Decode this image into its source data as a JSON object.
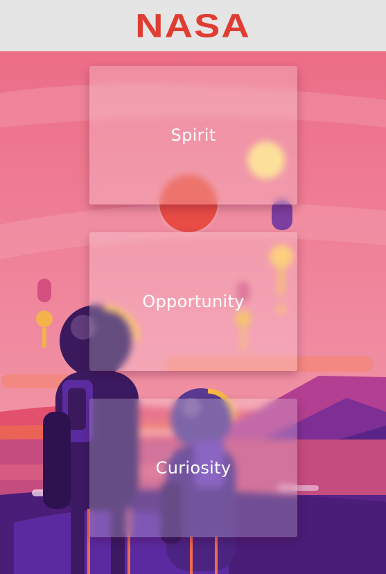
{
  "header": {
    "logo_text": "NASA",
    "logo_color": "#e03c31",
    "background": "#e5e5e5"
  },
  "rovers": [
    {
      "label": "Spirit"
    },
    {
      "label": "Opportunity"
    },
    {
      "label": "Curiosity"
    }
  ],
  "background_image": {
    "description_icon": "astronauts-on-alien-planet-illustration",
    "sky_color": "#ef7a92",
    "ground_color": "#4a1d78"
  }
}
